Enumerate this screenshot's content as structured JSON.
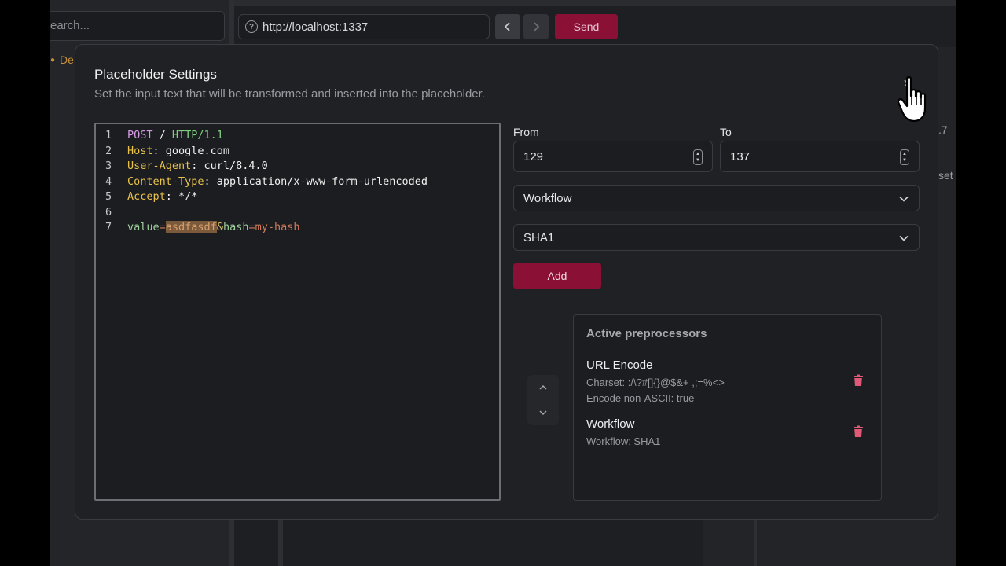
{
  "background": {
    "search_placeholder": "earch...",
    "sidebar_item": "De",
    "url": "http://localhost:1337",
    "send_label": "Send",
    "right_frag1": ".7",
    "right_frag2": "set"
  },
  "modal": {
    "title": "Placeholder Settings",
    "subtitle": "Set the input text that will be transformed and inserted into the placeholder."
  },
  "editor": {
    "line_numbers": [
      "1",
      "2",
      "3",
      "4",
      "5",
      "6",
      "7"
    ],
    "line1": {
      "method": "POST",
      "sep": " / ",
      "proto": "HTTP/1.1"
    },
    "line2": {
      "key": "Host",
      "value": ": google.com"
    },
    "line3": {
      "key": "User-Agent",
      "value": ": curl/8.4.0"
    },
    "line4": {
      "key": "Content-Type",
      "value": ": application/x-www-form-urlencoded"
    },
    "line5": {
      "key": "Accept",
      "value": ": */*"
    },
    "line7": {
      "p1": "value",
      "eq1": "=",
      "highlight": "asdfasdf",
      "amp": "&",
      "p2": "hash",
      "eq2": "=",
      "v2": "my-hash"
    }
  },
  "form": {
    "from_label": "From",
    "from_value": "129",
    "to_label": "To",
    "to_value": "137",
    "select1": "Workflow",
    "select2": "SHA1",
    "add_label": "Add"
  },
  "preprocessors": {
    "title": "Active preprocessors",
    "items": [
      {
        "name": "URL Encode",
        "details": [
          "Charset: :/\\?#[]{}@$&+ ,;=%<>",
          "Encode non-ASCII: true"
        ]
      },
      {
        "name": "Workflow",
        "details": [
          "Workflow: SHA1"
        ]
      }
    ]
  },
  "colors": {
    "accent": "#8a1036",
    "trash": "#e05a78"
  }
}
